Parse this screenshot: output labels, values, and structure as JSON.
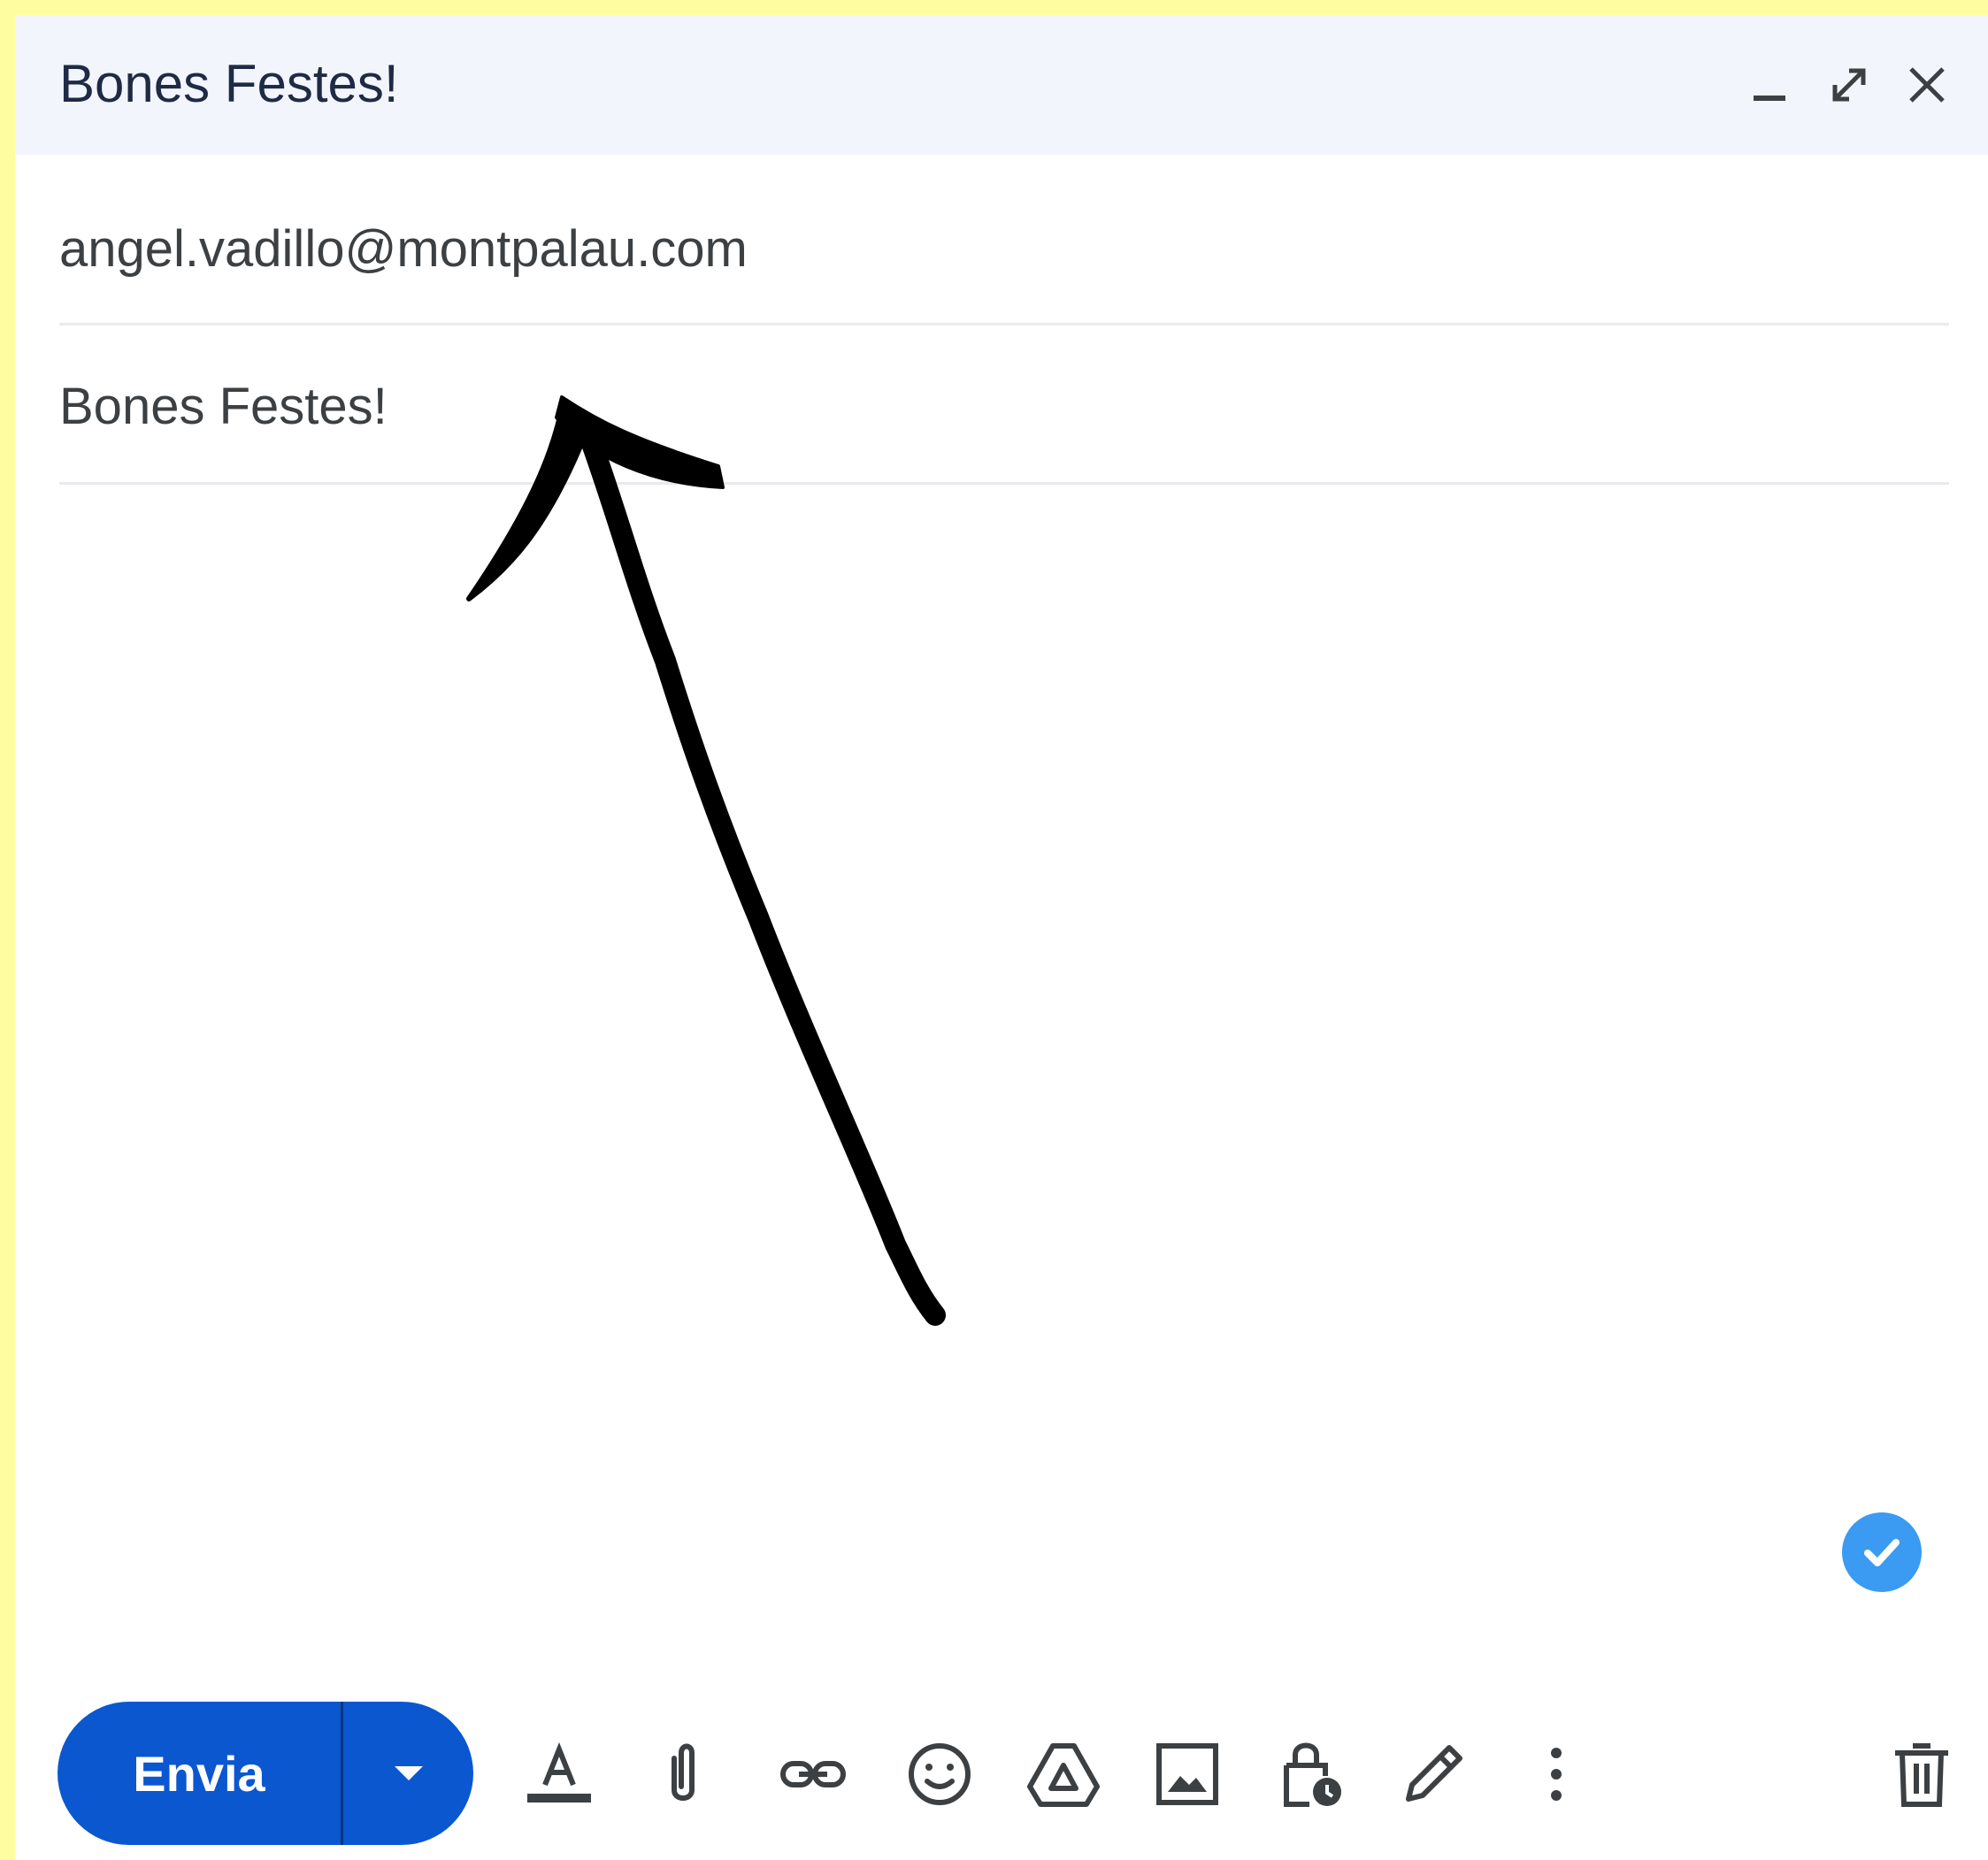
{
  "window": {
    "title": "Bones Festes!",
    "controls": [
      "minimize-icon",
      "expand-icon",
      "close-icon"
    ]
  },
  "recipients": {
    "value": "angel.vadillo@montpalau.com"
  },
  "subject": {
    "value": "Bones Festes!"
  },
  "message_body": {
    "value": ""
  },
  "annotation": {
    "type": "hand-drawn-arrow",
    "color": "#000000"
  },
  "status_badge": {
    "icon": "check-icon",
    "color": "#3b9af2"
  },
  "toolbar": {
    "send_label": "Envia",
    "send_color": "#0b57d0",
    "tools": [
      "format-text-icon",
      "attach-icon",
      "link-icon",
      "emoji-icon",
      "drive-icon",
      "image-icon",
      "confidential-mode-icon",
      "signature-icon",
      "more-options-icon"
    ],
    "discard": "trash-icon"
  }
}
